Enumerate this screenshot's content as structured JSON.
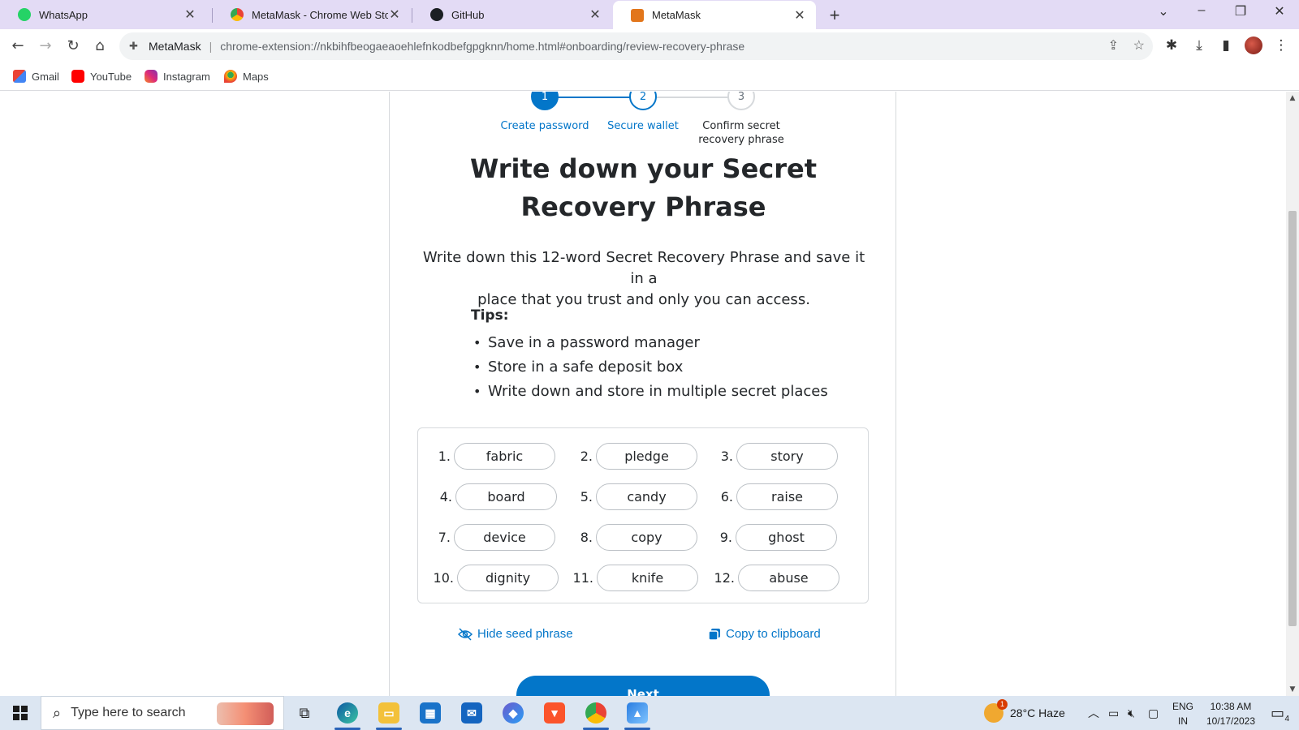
{
  "browser": {
    "tabs": [
      {
        "title": "WhatsApp",
        "icon": "whatsapp-icon",
        "color": "#25d366"
      },
      {
        "title": "MetaMask - Chrome Web Store",
        "icon": "chrome-web-store-icon",
        "color": "#4285f4"
      },
      {
        "title": "GitHub",
        "icon": "github-icon",
        "color": "#1b1f23"
      },
      {
        "title": "MetaMask",
        "icon": "metamask-fox-icon",
        "color": "#e2761b",
        "active": true
      }
    ],
    "address_bar": {
      "site_label": "MetaMask",
      "url": "chrome-extension://nkbihfbeogaeaoehlefnkodbefgpgknn/home.html#onboarding/review-recovery-phrase"
    },
    "bookmarks": [
      {
        "label": "Gmail",
        "icon": "gmail-icon"
      },
      {
        "label": "YouTube",
        "icon": "youtube-icon"
      },
      {
        "label": "Instagram",
        "icon": "instagram-icon"
      },
      {
        "label": "Maps",
        "icon": "maps-icon"
      }
    ]
  },
  "onboarding": {
    "steps": [
      {
        "number": "1",
        "label": "Create password",
        "state": "complete"
      },
      {
        "number": "2",
        "label": "Secure wallet",
        "state": "current"
      },
      {
        "number": "3",
        "label_line1": "Confirm secret",
        "label_line2": "recovery phrase",
        "state": "upcoming"
      }
    ],
    "title_line1": "Write down your Secret",
    "title_line2": "Recovery Phrase",
    "description_line1": "Write down this 12-word Secret Recovery Phrase and save it in a",
    "description_line2": "place that you trust and only you can access.",
    "tips_heading": "Tips:",
    "tips": [
      "Save in a password manager",
      "Store in a safe deposit box",
      "Write down and store in multiple secret places"
    ],
    "phrase": [
      {
        "num": "1.",
        "word": "fabric"
      },
      {
        "num": "2.",
        "word": "pledge"
      },
      {
        "num": "3.",
        "word": "story"
      },
      {
        "num": "4.",
        "word": "board"
      },
      {
        "num": "5.",
        "word": "candy"
      },
      {
        "num": "6.",
        "word": "raise"
      },
      {
        "num": "7.",
        "word": "device"
      },
      {
        "num": "8.",
        "word": "copy"
      },
      {
        "num": "9.",
        "word": "ghost"
      },
      {
        "num": "10.",
        "word": "dignity"
      },
      {
        "num": "11.",
        "word": "knife"
      },
      {
        "num": "12.",
        "word": "abuse"
      }
    ],
    "hide_label": "Hide seed phrase",
    "copy_label": "Copy to clipboard",
    "next_label": "Next",
    "accent_color": "#0376c9"
  },
  "taskbar": {
    "search_placeholder": "Type here to search",
    "weather": "28°C  Haze",
    "weather_badge": "1",
    "language_line1": "ENG",
    "language_line2": "IN",
    "time": "10:38 AM",
    "date": "10/17/2023",
    "notification_count": "4"
  }
}
